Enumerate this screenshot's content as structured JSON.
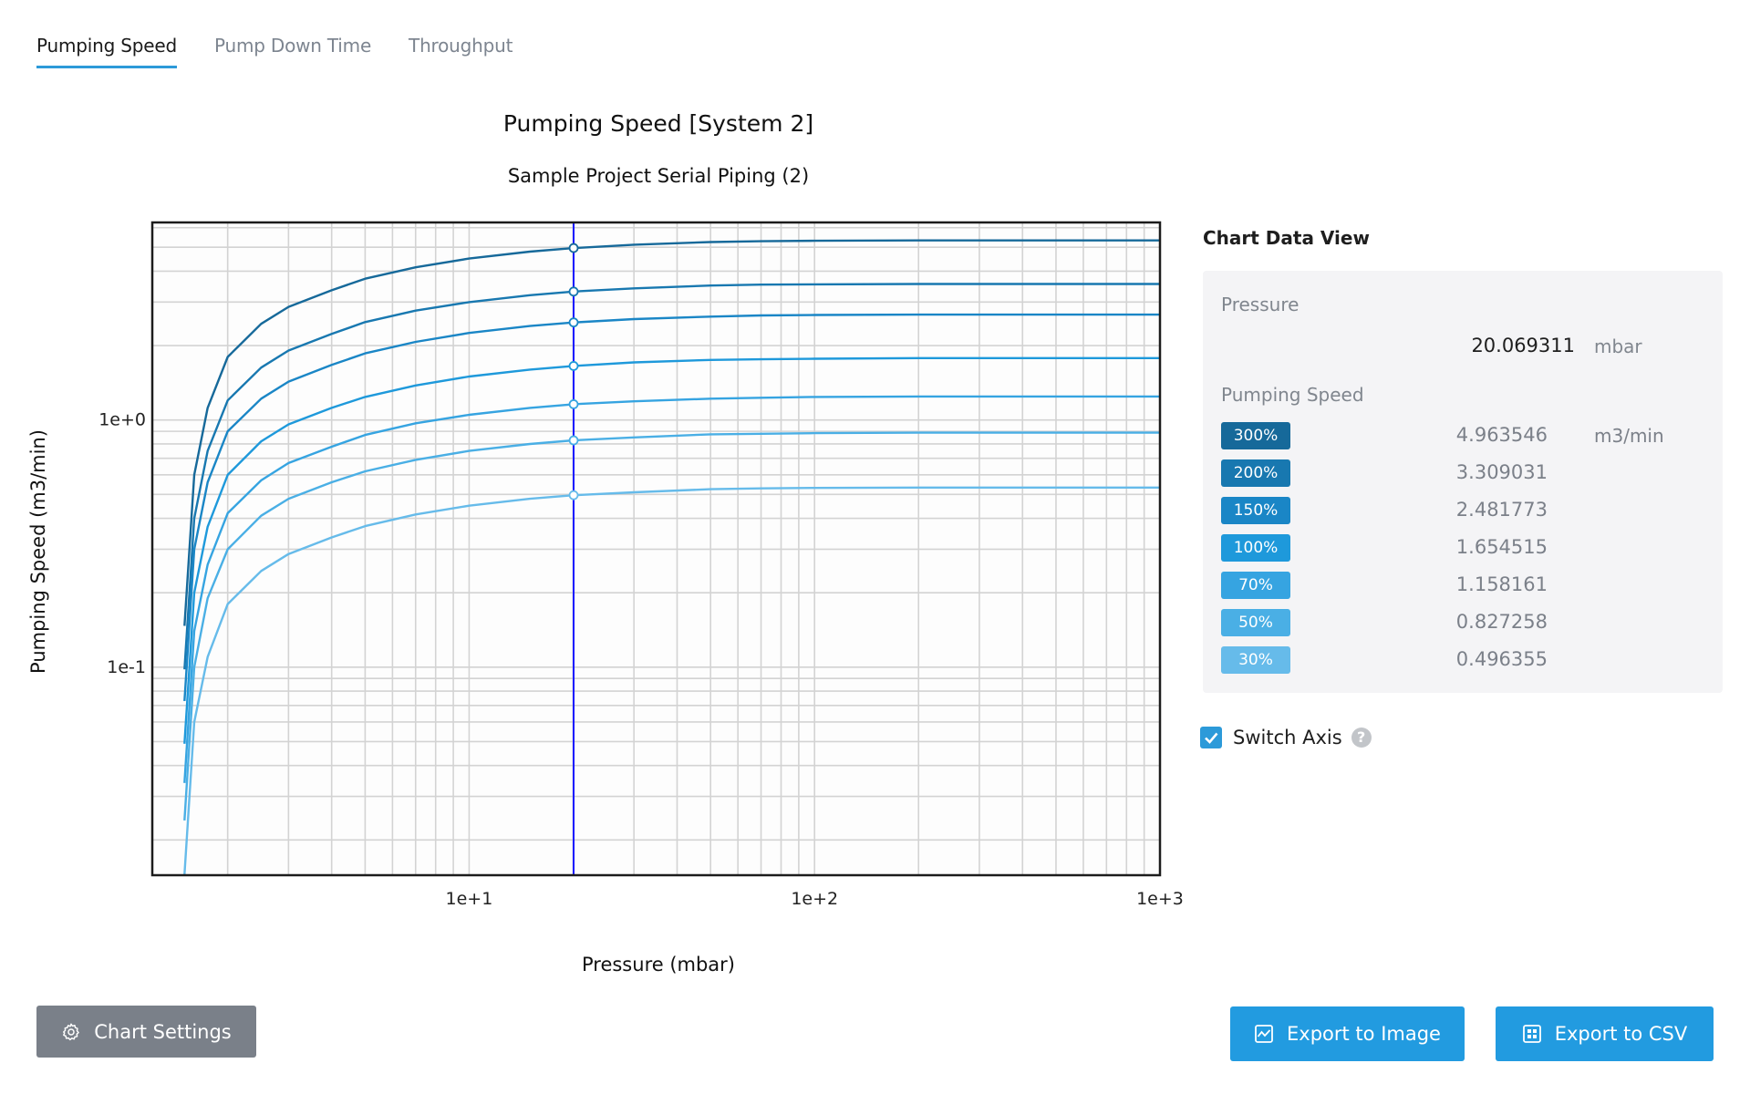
{
  "tabs": [
    {
      "label": "Pumping Speed",
      "active": true
    },
    {
      "label": "Pump Down Time",
      "active": false
    },
    {
      "label": "Throughput",
      "active": false
    }
  ],
  "panel": {
    "title": "Chart Data View",
    "pressure_label": "Pressure",
    "pressure_value": "20.069311",
    "pressure_unit": "mbar",
    "speed_label": "Pumping Speed",
    "speed_unit": "m3/min",
    "rows": [
      {
        "badge": "300%",
        "value": "4.963546",
        "color": "#16699a"
      },
      {
        "badge": "200%",
        "value": "3.309031",
        "color": "#1878b0"
      },
      {
        "badge": "150%",
        "value": "2.481773",
        "color": "#1a86c6"
      },
      {
        "badge": "100%",
        "value": "1.654515",
        "color": "#1e99db"
      },
      {
        "badge": "70%",
        "value": "1.158161",
        "color": "#36a4e1"
      },
      {
        "badge": "50%",
        "value": "0.827258",
        "color": "#4aafe5"
      },
      {
        "badge": "30%",
        "value": "0.496355",
        "color": "#66bbea"
      }
    ],
    "switch_axis_label": "Switch Axis",
    "switch_axis_checked": true,
    "help_glyph": "?"
  },
  "buttons": {
    "chart_settings": "Chart Settings",
    "export_image": "Export to Image",
    "export_csv": "Export to CSV"
  },
  "chart_data": {
    "type": "line",
    "title": "Pumping Speed [System 2]",
    "subtitle": "Sample Project Serial Piping (2)",
    "xlabel": "Pressure (mbar)",
    "ylabel": "Pumping Speed (m3/min)",
    "xscale": "log",
    "yscale": "log",
    "xlim": [
      1.21,
      1000
    ],
    "ylim": [
      0.0144,
      6.3
    ],
    "x_ticks": [
      {
        "value": 10,
        "label": "1e+1"
      },
      {
        "value": 100,
        "label": "1e+2"
      },
      {
        "value": 1000,
        "label": "1e+3"
      }
    ],
    "y_ticks": [
      {
        "value": 0.1,
        "label": "1e-1"
      },
      {
        "value": 1,
        "label": "1e+0"
      }
    ],
    "grid": true,
    "cursor": {
      "x": 20.069311,
      "color": "#1a1aff"
    },
    "x": [
      1.5,
      1.6,
      1.75,
      2,
      2.5,
      3,
      4,
      5,
      7,
      10,
      15,
      20.069311,
      30,
      50,
      70,
      100,
      200,
      500,
      1000
    ],
    "series": [
      {
        "name": "300%",
        "color": "#16699a",
        "values": [
          0.147,
          0.6,
          1.12,
          1.8,
          2.45,
          2.87,
          3.35,
          3.73,
          4.15,
          4.5,
          4.8,
          4.963546,
          5.12,
          5.25,
          5.29,
          5.31,
          5.33,
          5.33,
          5.33
        ]
      },
      {
        "name": "200%",
        "color": "#1878b0",
        "values": [
          0.098,
          0.4,
          0.75,
          1.2,
          1.63,
          1.91,
          2.23,
          2.49,
          2.77,
          3.0,
          3.2,
          3.309031,
          3.41,
          3.5,
          3.53,
          3.54,
          3.55,
          3.55,
          3.55
        ]
      },
      {
        "name": "150%",
        "color": "#1a86c6",
        "values": [
          0.073,
          0.3,
          0.56,
          0.9,
          1.22,
          1.43,
          1.67,
          1.86,
          2.07,
          2.25,
          2.4,
          2.481773,
          2.56,
          2.62,
          2.65,
          2.66,
          2.67,
          2.67,
          2.67
        ]
      },
      {
        "name": "100%",
        "color": "#1e99db",
        "values": [
          0.049,
          0.2,
          0.37,
          0.6,
          0.82,
          0.96,
          1.12,
          1.24,
          1.38,
          1.5,
          1.6,
          1.654515,
          1.71,
          1.75,
          1.76,
          1.77,
          1.78,
          1.78,
          1.78
        ]
      },
      {
        "name": "70%",
        "color": "#36a4e1",
        "values": [
          0.034,
          0.14,
          0.26,
          0.42,
          0.57,
          0.67,
          0.78,
          0.87,
          0.97,
          1.05,
          1.12,
          1.158161,
          1.19,
          1.22,
          1.23,
          1.24,
          1.245,
          1.245,
          1.245
        ]
      },
      {
        "name": "50%",
        "color": "#4aafe5",
        "values": [
          0.024,
          0.1,
          0.19,
          0.3,
          0.41,
          0.48,
          0.56,
          0.62,
          0.69,
          0.75,
          0.8,
          0.827258,
          0.85,
          0.875,
          0.88,
          0.885,
          0.889,
          0.889,
          0.889
        ]
      },
      {
        "name": "30%",
        "color": "#66bbea",
        "values": [
          0.0145,
          0.06,
          0.11,
          0.18,
          0.245,
          0.287,
          0.335,
          0.372,
          0.415,
          0.45,
          0.48,
          0.496355,
          0.51,
          0.525,
          0.529,
          0.531,
          0.533,
          0.533,
          0.533
        ]
      }
    ]
  }
}
